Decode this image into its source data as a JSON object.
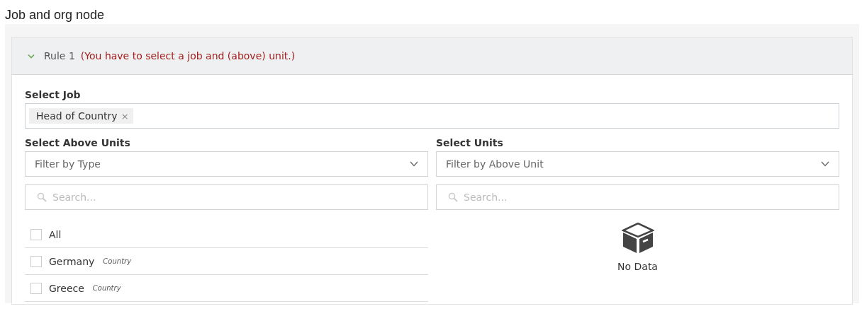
{
  "page_title": "Job and org node",
  "rule": {
    "expanded": true,
    "title": "Rule 1",
    "warning": "(You have to select a job and (above) unit.)"
  },
  "select_job": {
    "label": "Select Job",
    "tags": [
      {
        "label": "Head of Country",
        "remove": "×"
      }
    ]
  },
  "above_units": {
    "label": "Select Above Units",
    "filter": {
      "placeholder": "Filter by Type"
    },
    "search": {
      "placeholder": "Search..."
    },
    "items": [
      {
        "name": "All",
        "checked": false
      },
      {
        "name": "Germany",
        "type": "Country",
        "checked": false
      },
      {
        "name": "Greece",
        "type": "Country",
        "checked": false
      }
    ]
  },
  "units": {
    "label": "Select Units",
    "filter": {
      "placeholder": "Filter by Above Unit"
    },
    "search": {
      "placeholder": "Search..."
    },
    "empty": "No Data"
  }
}
